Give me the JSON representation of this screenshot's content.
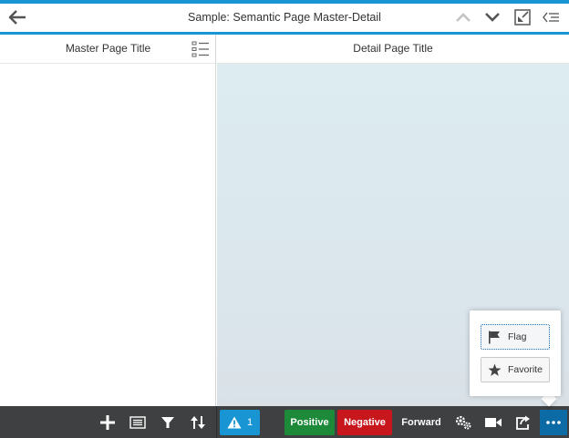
{
  "header": {
    "title": "Sample: Semantic Page Master-Detail",
    "icons": [
      "back-arrow-icon",
      "navigate-up-icon",
      "navigate-down-icon",
      "exit-fullscreen-icon",
      "menu-collapse-icon"
    ]
  },
  "master": {
    "title": "Master Page Title",
    "icons": [
      "list-icon"
    ]
  },
  "detail": {
    "title": "Detail Page Title"
  },
  "footer": {
    "master_icons": [
      "add-icon",
      "group-icon",
      "filter-icon",
      "sort-icon"
    ],
    "messages": {
      "count": "1",
      "icon": "warning-icon"
    },
    "positive_label": "Positive",
    "negative_label": "Negative",
    "forward_label": "Forward",
    "action_icons": [
      "settings-icon",
      "video-icon",
      "share-icon",
      "overflow-icon"
    ]
  },
  "popover": {
    "items": [
      {
        "label": "Flag",
        "icon": "flag-icon",
        "focused": true
      },
      {
        "label": "Favorite",
        "icon": "star-icon",
        "focused": false
      }
    ]
  },
  "colors": {
    "accent": "#1a95d4",
    "footer_bg": "#3f4042",
    "positive": "#1d8a3a",
    "negative": "#c8161d",
    "overflow_active": "#0c6ba5",
    "detail_bg": "#dcedf2"
  }
}
